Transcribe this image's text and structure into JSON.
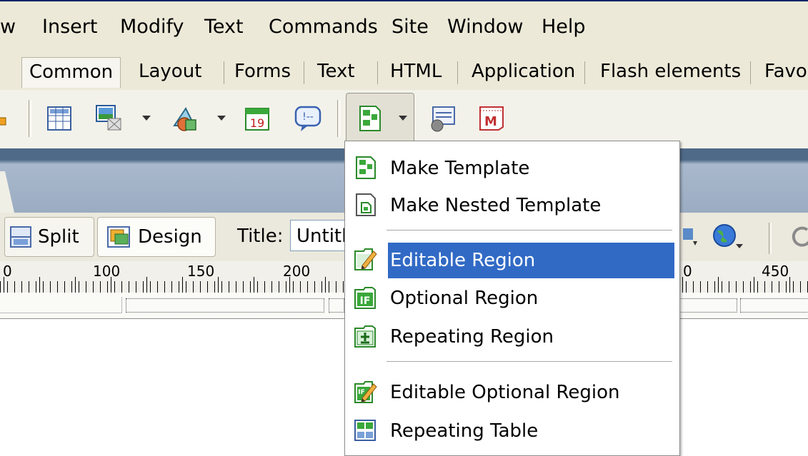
{
  "menubar": {
    "items": [
      "w",
      "Insert",
      "Modify",
      "Text",
      "Commands",
      "Site",
      "Window",
      "Help"
    ]
  },
  "insert_tabs": [
    "Common",
    "Layout",
    "Forms",
    "Text",
    "HTML",
    "Application",
    "Flash elements",
    "Favo"
  ],
  "toolbar_icons": [
    "table-icon",
    "image-icon",
    "media-icon",
    "date-icon",
    "comment-icon",
    "templates-icon",
    "tag-chooser-icon",
    "email-icon"
  ],
  "doc_toolbar": {
    "split_label": "Split",
    "design_label": "Design",
    "title_label": "Title:",
    "title_value": "Untitl"
  },
  "ruler": {
    "labels_left": [
      "0",
      "100",
      "150",
      "200"
    ],
    "labels_right": [
      "0",
      "450"
    ]
  },
  "template_menu": {
    "items": [
      {
        "label": "Make Template",
        "icon": "make-template-icon"
      },
      {
        "label": "Make Nested Template",
        "icon": "nested-template-icon"
      },
      {
        "label": "Editable Region",
        "icon": "editable-region-icon",
        "highlighted": true
      },
      {
        "label": "Optional Region",
        "icon": "optional-region-icon"
      },
      {
        "label": "Repeating Region",
        "icon": "repeating-region-icon"
      },
      {
        "label": "Editable Optional Region",
        "icon": "editable-optional-region-icon"
      },
      {
        "label": "Repeating Table",
        "icon": "repeating-table-icon"
      }
    ],
    "highlight_color": "#316ac5"
  }
}
